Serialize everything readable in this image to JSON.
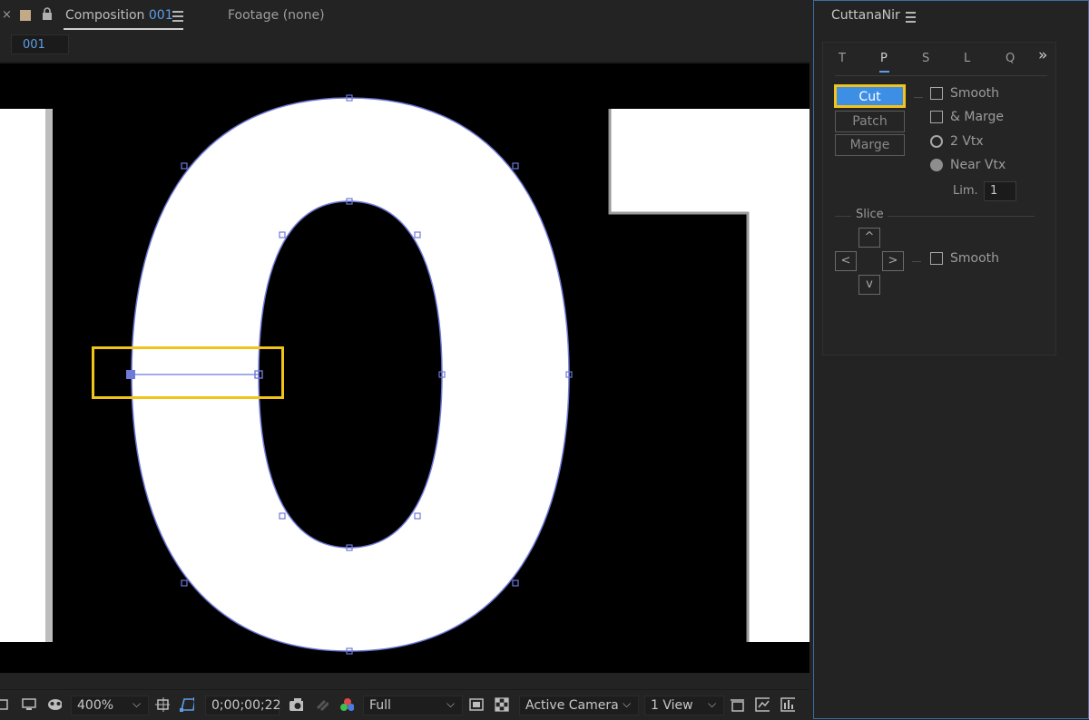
{
  "comp_panel": {
    "close_glyph": "×",
    "tab_label_prefix": "Composition",
    "tab_label_num": "001",
    "footage_tab": "Footage (none)",
    "comp_name_tag": "001"
  },
  "canvas": {
    "displayed_text": "001",
    "background": "#000000",
    "fill": "#ffffff",
    "path_color": "#6f79d8",
    "highlight_color": "#f2c418"
  },
  "toolbar": {
    "zoom": "400%",
    "timecode": "0;00;00;22",
    "resolution": "Full",
    "camera": "Active Camera",
    "view_layout": "1 View",
    "chevron": "⌵"
  },
  "panel": {
    "title": "CuttanaNir",
    "tabs": [
      "T",
      "P",
      "S",
      "L",
      "Q"
    ],
    "active_tab": "P",
    "more_glyph": "»",
    "buttons": {
      "cut": "Cut",
      "patch": "Patch",
      "marge": "Marge"
    },
    "options": {
      "smooth": "Smooth",
      "and_marge": "& Marge",
      "two_vtx": "2 Vtx",
      "near_vtx": "Near Vtx",
      "lim_label": "Lim.",
      "lim_value": "1"
    },
    "slice": {
      "label": "Slice",
      "up": "^",
      "left": "<",
      "right": ">",
      "down": "v",
      "smooth": "Smooth"
    }
  },
  "colors": {
    "accent": "#3d8fe6",
    "highlight": "#f2c418",
    "panel_border": "#3a6ea5"
  }
}
